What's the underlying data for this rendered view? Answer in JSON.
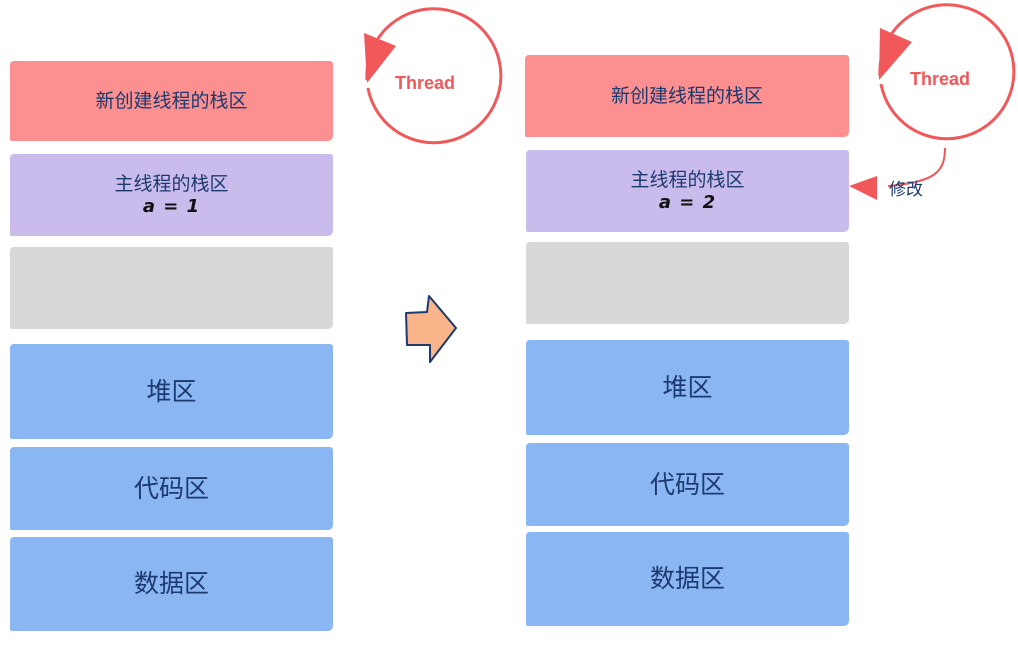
{
  "left": {
    "new_stack": "新创建线程的栈区",
    "main_stack": "主线程的栈区",
    "main_var": "a = 1",
    "heap": "堆区",
    "code": "代码区",
    "data": "数据区",
    "thread": "Thread"
  },
  "right": {
    "new_stack": "新创建线程的栈区",
    "main_stack": "主线程的栈区",
    "main_var": "a = 2",
    "heap": "堆区",
    "code": "代码区",
    "data": "数据区",
    "thread": "Thread",
    "modify": "修改"
  },
  "colors": {
    "new_stack": "#fc8f8f",
    "main_stack": "#c9bcec",
    "gap": "#d8d8d8",
    "memory": "#8bb6f4",
    "thread": "#f0585a",
    "arrow": "#f9b48a"
  }
}
